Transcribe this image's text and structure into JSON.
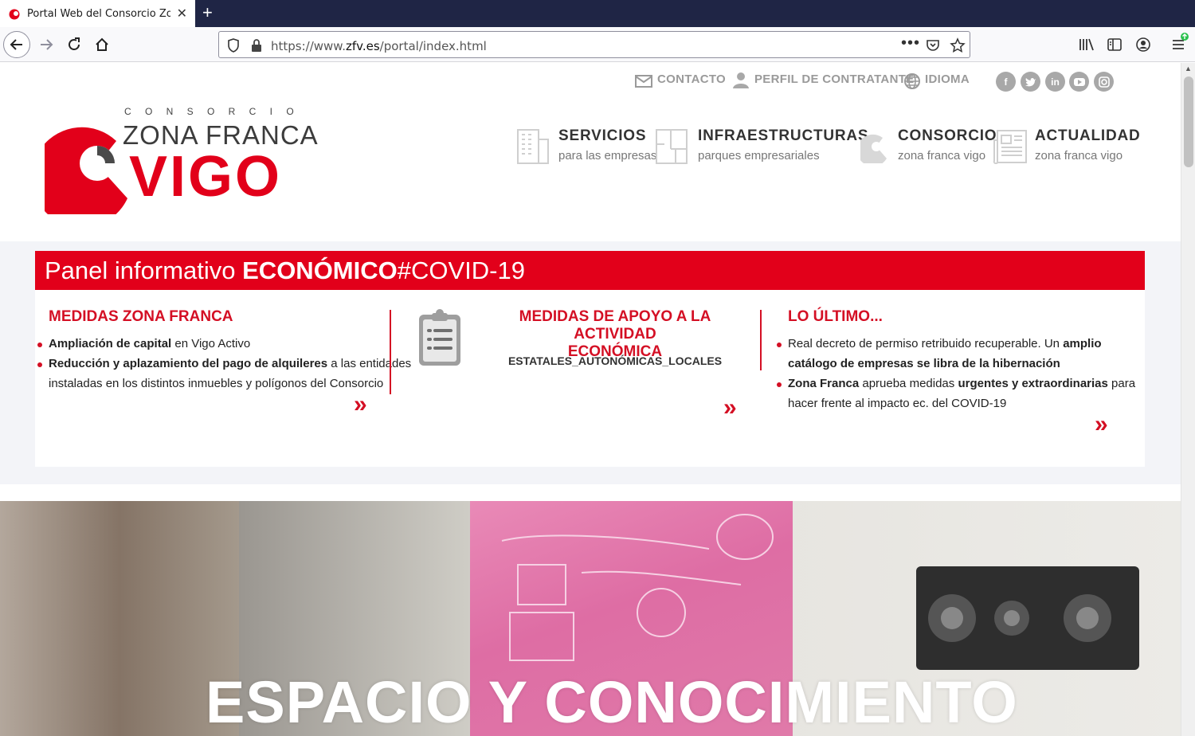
{
  "browser": {
    "tab_title": "Portal Web del Consorcio Zona Franca de Vigo",
    "url_prefix": "https://www.",
    "url_domain": "zfv.es",
    "url_path": "/portal/index.html"
  },
  "utility_nav": {
    "contacto": "CONTACTO",
    "perfil": "PERFIL DE CONTRATANTE",
    "idioma": "IDIOMA"
  },
  "logo": {
    "consorcio": "C O N S O R C I O",
    "zona_franca": "ZONA FRANCA",
    "vigo": "VIGO"
  },
  "main_menu": [
    {
      "title": "SERVICIOS",
      "subtitle": "para las empresas"
    },
    {
      "title": "INFRAESTRUCTURAS",
      "subtitle": "parques empresariales"
    },
    {
      "title": "CONSORCIO",
      "subtitle": "zona franca vigo"
    },
    {
      "title": "ACTUALIDAD",
      "subtitle": "zona franca vigo"
    }
  ],
  "covid": {
    "header_light": "Panel informativo ",
    "header_bold": "ECONÓMICO",
    "header_tag": "#COVID-19",
    "col1": {
      "title": "MEDIDAS ZONA FRANCA",
      "item1_bold": "Ampliación de capital",
      "item1_rest": " en Vigo Activo",
      "item2_bold": "Reducción y aplazamiento del pago de alquileres",
      "item2_rest_line1": " a las entidades",
      "item2_line2": "instaladas en los distintos inmuebles y polígonos del Consorcio"
    },
    "col2": {
      "title_line1": "MEDIDAS DE APOYO A LA ACTIVIDAD",
      "title_line2": "ECONÓMICA",
      "subtitle": "ESTATALES_AUTONÓMICAS_LOCALES"
    },
    "col3": {
      "title": "LO ÚLTIMO...",
      "item1_text": "Real decreto de permiso retribuido recuperable. Un ",
      "item1_bold1": "amplio",
      "item1_bold2": "catálogo de empresas se libra de la hibernación",
      "item2_bold": "Zona Franca",
      "item2_mid": " aprueba medidas ",
      "item2_bold2": "urgentes y extraordinarias",
      "item2_end": " para",
      "item2_line2": "hacer frente al impacto ec. del COVID-19"
    },
    "chevron": "»"
  },
  "hero": {
    "title": "ESPACIO Y CONOCIMIENTO"
  },
  "colors": {
    "brand_red": "#e2001a",
    "tabbar": "#1f2545",
    "text_gray": "#9a9a9a"
  }
}
